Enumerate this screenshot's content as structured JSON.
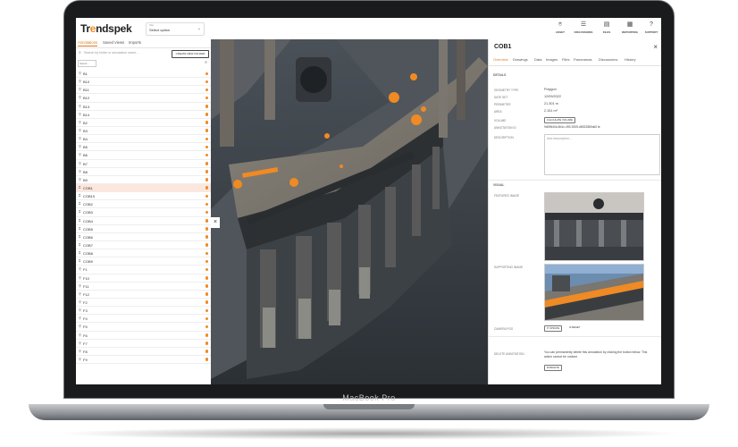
{
  "device": {
    "label": "MacBook Pro"
  },
  "app": {
    "brand_pre": "Tr",
    "brand_o": "e",
    "brand_mid": "nds",
    "brand_p": "pek",
    "site_label": "Site",
    "site_value": "Select option"
  },
  "topnav": [
    {
      "label": "ASSET",
      "icon": "pin-icon",
      "glyph": "⌾"
    },
    {
      "label": "DISCUSSIONS",
      "icon": "chat-icon",
      "glyph": "☰"
    },
    {
      "label": "FILES",
      "icon": "files-icon",
      "glyph": "▤"
    },
    {
      "label": "REPORTING",
      "icon": "calendar-icon",
      "glyph": "▦"
    },
    {
      "label": "SUPPORT",
      "icon": "help-icon",
      "glyph": "?"
    }
  ],
  "left": {
    "tabs": [
      "Annotations",
      "Saved Views",
      "Imports"
    ],
    "search_placeholder": "Search by folder or annotation name...",
    "new_folder": "CREATE NEW FOLDER",
    "select_label": "Select...",
    "items": [
      {
        "label": "B1",
        "type": "pin"
      },
      {
        "label": "B10",
        "type": "pin"
      },
      {
        "label": "B11",
        "type": "pin"
      },
      {
        "label": "B12",
        "type": "pin"
      },
      {
        "label": "B13",
        "type": "pin"
      },
      {
        "label": "B14",
        "type": "pin"
      },
      {
        "label": "B2",
        "type": "pin"
      },
      {
        "label": "B3",
        "type": "pin"
      },
      {
        "label": "B4",
        "type": "pin"
      },
      {
        "label": "B5",
        "type": "pin"
      },
      {
        "label": "B6",
        "type": "pin"
      },
      {
        "label": "B7",
        "type": "pin"
      },
      {
        "label": "B8",
        "type": "pin"
      },
      {
        "label": "B9",
        "type": "pin"
      },
      {
        "label": "COB1",
        "type": "poly",
        "selected": true
      },
      {
        "label": "COB10",
        "type": "poly"
      },
      {
        "label": "COB2",
        "type": "poly"
      },
      {
        "label": "COB3",
        "type": "poly"
      },
      {
        "label": "COB4",
        "type": "poly"
      },
      {
        "label": "COB5",
        "type": "poly"
      },
      {
        "label": "COB6",
        "type": "poly"
      },
      {
        "label": "COB7",
        "type": "poly"
      },
      {
        "label": "COB8",
        "type": "poly"
      },
      {
        "label": "COB9",
        "type": "poly"
      },
      {
        "label": "F1",
        "type": "pin"
      },
      {
        "label": "F10",
        "type": "pin"
      },
      {
        "label": "F11",
        "type": "pin"
      },
      {
        "label": "F12",
        "type": "pin"
      },
      {
        "label": "F2",
        "type": "pin"
      },
      {
        "label": "F3",
        "type": "pin"
      },
      {
        "label": "F4",
        "type": "pin"
      },
      {
        "label": "F5",
        "type": "pin"
      },
      {
        "label": "F6",
        "type": "pin"
      },
      {
        "label": "F7",
        "type": "pin"
      },
      {
        "label": "F8",
        "type": "pin"
      },
      {
        "label": "F9",
        "type": "pin"
      }
    ]
  },
  "right": {
    "title": "COB1",
    "tabs": [
      "Overview",
      "Drawings",
      "Data",
      "Images",
      "Files",
      "Panoramas",
      "Discussions",
      "History"
    ],
    "details_heading": "DETAILS",
    "details": [
      {
        "key": "GEOMETRY TYPE",
        "value": "Polygon"
      },
      {
        "key": "DATE SET",
        "value": "12/09/2022"
      },
      {
        "key": "PERIMETER",
        "value": "21.301 m"
      },
      {
        "key": "AREA",
        "value": "2.151 m²"
      }
    ],
    "volume_key": "VOLUME",
    "volume_button": "CALCULATE VOLUME",
    "annotation_id_key": "ANNOTATION ID",
    "annotation_id": "9d09640d-6b1c-493-9205-d8022880dd2 ⧉",
    "description_key": "DESCRIPTION",
    "description_placeholder": "Add description...",
    "visual_heading": "VISUAL",
    "featured_label": "FEATURED IMAGE",
    "supporting_label": "SUPPORTING IMAGE",
    "camera_key": "CAMERA POS",
    "camera_update": "⟳ UPDATE",
    "camera_reset": "⊘ RESET",
    "delete_key": "DELETE ANNOTATION",
    "delete_text": "You can permanently delete this annotation by clicking the button below. This action cannot be undone.",
    "delete_button": "⊠ DELETE"
  },
  "colors": {
    "accent": "#f08a24",
    "selected_row": "#fde6dc"
  }
}
